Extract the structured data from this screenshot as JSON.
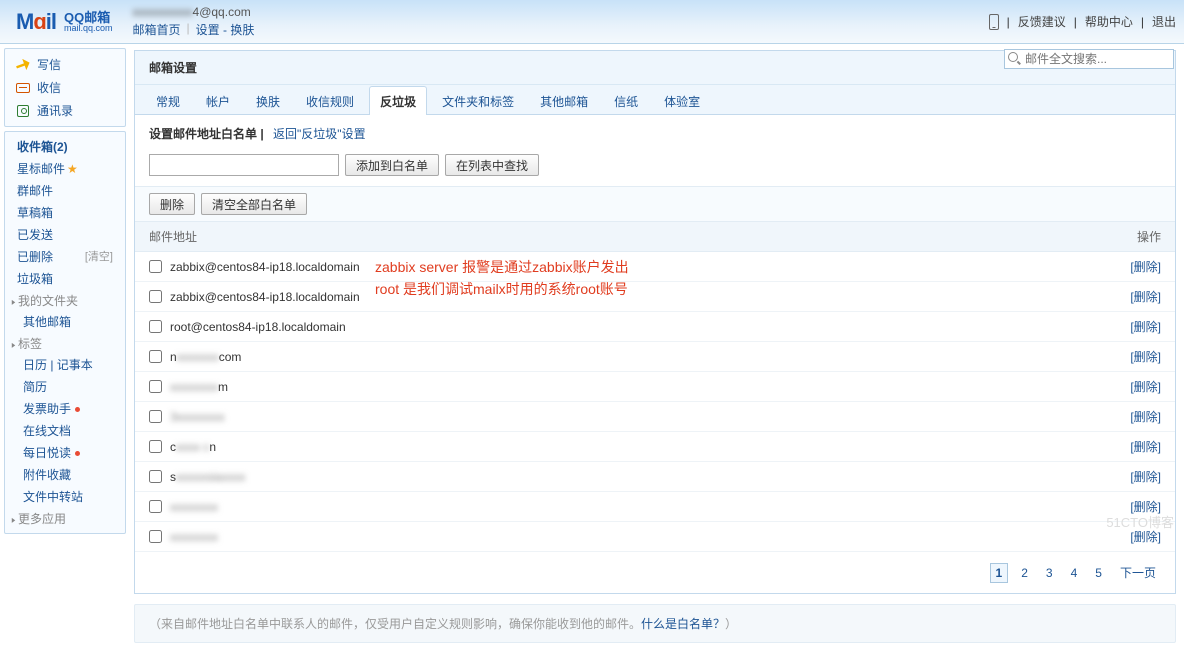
{
  "header": {
    "email_suffix": "4@qq.com",
    "nav": [
      "邮箱首页",
      "设置 - 换肤"
    ],
    "right_links": [
      "反馈建议",
      "帮助中心",
      "退出"
    ],
    "search_placeholder": "邮件全文搜索..."
  },
  "sidebar": {
    "main_actions": [
      {
        "label": "写信",
        "icon": "write"
      },
      {
        "label": "收信",
        "icon": "inbox"
      },
      {
        "label": "通讯录",
        "icon": "contact"
      }
    ],
    "folders": [
      {
        "label": "收件箱(2)",
        "bold": true
      },
      {
        "label": "星标邮件",
        "star": true
      },
      {
        "label": "群邮件"
      },
      {
        "label": "草稿箱"
      },
      {
        "label": "已发送"
      },
      {
        "label": "已删除",
        "clear": "[清空]"
      },
      {
        "label": "垃圾箱"
      }
    ],
    "groups": [
      {
        "label": "我的文件夹",
        "sub": [
          "其他邮箱"
        ]
      },
      {
        "label": "标签",
        "sub": [
          "日历 | 记事本",
          "简历",
          "发票助手",
          "在线文档",
          "每日悦读",
          "附件收藏",
          "文件中转站"
        ],
        "dots": [
          2,
          4
        ]
      },
      {
        "label": "更多应用",
        "sub": []
      }
    ]
  },
  "panel": {
    "title": "邮箱设置",
    "tabs": [
      "常规",
      "帐户",
      "换肤",
      "收信规则",
      "反垃圾",
      "文件夹和标签",
      "其他邮箱",
      "信纸",
      "体验室"
    ],
    "active_tab": 4,
    "sub_title": "设置邮件地址白名单",
    "back_link": "返回\"反垃圾\"设置",
    "add_btn": "添加到白名单",
    "find_btn": "在列表中查找",
    "delete_btn": "删除",
    "clear_all_btn": "清空全部白名单",
    "col_addr": "邮件地址",
    "col_action": "操作",
    "row_action": "[删除]",
    "rows": [
      {
        "text": "zabbix@centos84-ip18.localdomain"
      },
      {
        "text": "zabbix@centos84-ip18.localdomain"
      },
      {
        "text": "root@centos84-ip18.localdomain"
      },
      {
        "text": "n",
        "blur": "xxxxxxx",
        "suffix": "com"
      },
      {
        "text": "",
        "blur": "xxxxxxxx",
        "suffix": "m"
      },
      {
        "text": "",
        "blur": "3xxxxxxxx",
        "suffix": ""
      },
      {
        "text": "c",
        "blur": "xxxx c",
        "suffix": "n"
      },
      {
        "text": "s",
        "blur": "xxxxxsiaxxxx",
        "suffix": ""
      },
      {
        "text": "",
        "blur": "xxxxxxxx",
        "suffix": ""
      },
      {
        "text": "",
        "blur": "xxxxxxxx",
        "suffix": ""
      }
    ],
    "pager": [
      "1",
      "2",
      "3",
      "4",
      "5",
      "下一页"
    ],
    "footer": "（来自邮件地址白名单中联系人的邮件，仅受用户自定义规则影响，确保你能收到他的邮件。什么是白名单？）",
    "footer_link": "什么是白名单？"
  },
  "annotation": {
    "line1": "zabbix server 报警是通过zabbix账户发出",
    "line2": "root  是我们调试mailx时用的系统root账号"
  },
  "watermark": "51CTO博客"
}
